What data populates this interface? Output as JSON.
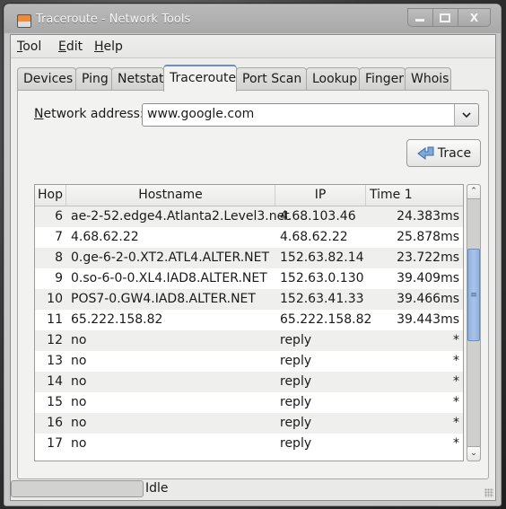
{
  "window": {
    "title": "Traceroute - Network Tools",
    "controls": {
      "minimize": "minimize",
      "maximize": "maximize",
      "close": "X"
    }
  },
  "menubar": {
    "items": [
      {
        "label_ul": "T",
        "label_rest": "ool"
      },
      {
        "label_ul": "E",
        "label_rest": "dit"
      },
      {
        "label_ul": "H",
        "label_rest": "elp"
      }
    ]
  },
  "tabs": [
    {
      "label": "Devices",
      "active": false
    },
    {
      "label": "Ping",
      "active": false
    },
    {
      "label": "Netstat",
      "active": false
    },
    {
      "label": "Traceroute",
      "active": true
    },
    {
      "label": "Port Scan",
      "active": false
    },
    {
      "label": "Lookup",
      "active": false
    },
    {
      "label": "Finger",
      "active": false
    },
    {
      "label": "Whois",
      "active": false
    }
  ],
  "traceroute": {
    "address_label_ul": "N",
    "address_label_rest": "etwork address:",
    "address_value": "www.google.com",
    "trace_button": "Trace",
    "columns": [
      "Hop",
      "Hostname",
      "IP",
      "Time 1"
    ],
    "rows": [
      {
        "hop": "6",
        "hostname": "ae-2-52.edge4.Atlanta2.Level3.net",
        "ip": "4.68.103.46",
        "time": "24.383ms"
      },
      {
        "hop": "7",
        "hostname": "4.68.62.22",
        "ip": "4.68.62.22",
        "time": "25.878ms"
      },
      {
        "hop": "8",
        "hostname": "0.ge-6-2-0.XT2.ATL4.ALTER.NET",
        "ip": "152.63.82.14",
        "time": "23.722ms"
      },
      {
        "hop": "9",
        "hostname": "0.so-6-0-0.XL4.IAD8.ALTER.NET",
        "ip": "152.63.0.130",
        "time": "39.409ms"
      },
      {
        "hop": "10",
        "hostname": "POS7-0.GW4.IAD8.ALTER.NET",
        "ip": "152.63.41.33",
        "time": "39.466ms"
      },
      {
        "hop": "11",
        "hostname": "65.222.158.82",
        "ip": "65.222.158.82",
        "time": "39.443ms"
      },
      {
        "hop": "12",
        "hostname": "no",
        "ip": "reply",
        "time": "*"
      },
      {
        "hop": "13",
        "hostname": "no",
        "ip": "reply",
        "time": "*"
      },
      {
        "hop": "14",
        "hostname": "no",
        "ip": "reply",
        "time": "*"
      },
      {
        "hop": "15",
        "hostname": "no",
        "ip": "reply",
        "time": "*"
      },
      {
        "hop": "16",
        "hostname": "no",
        "ip": "reply",
        "time": "*"
      },
      {
        "hop": "17",
        "hostname": "no",
        "ip": "reply",
        "time": "*"
      }
    ]
  },
  "statusbar": {
    "text": "Idle",
    "progress": 0
  }
}
